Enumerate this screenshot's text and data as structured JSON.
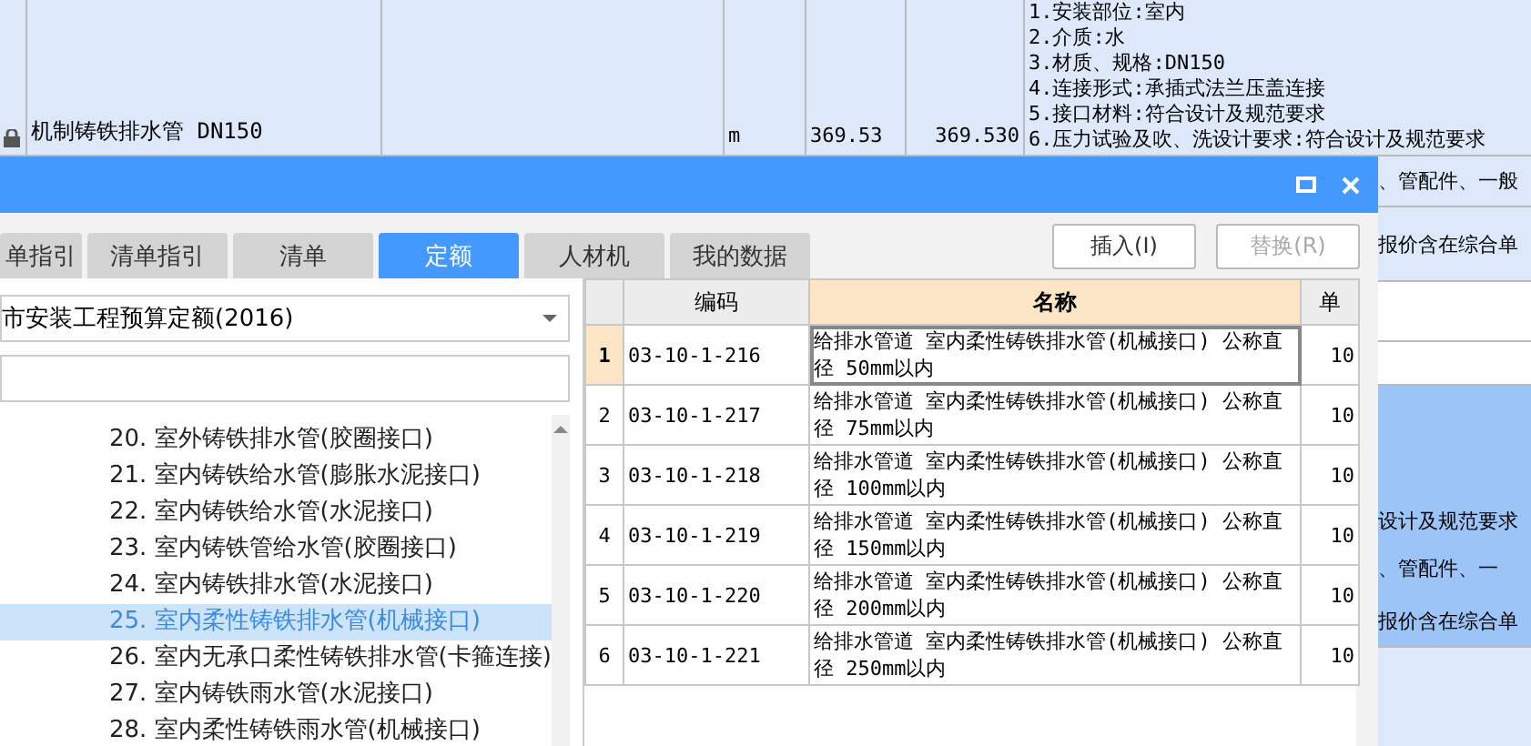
{
  "sheet": {
    "row": {
      "locked": true,
      "name": "机制铸铁排水管 DN150",
      "unit": "m",
      "quantity": "369.53",
      "amount": "369.530",
      "features": [
        "1.安装部位:室内",
        "2.介质:水",
        "3.材质、规格:DN150",
        "4.连接形式:承插式法兰压盖连接",
        "5.接口材料:符合设计及规范要求",
        "6.压力试验及吹、洗设计要求:符合设计及规范要求"
      ]
    },
    "side_rows": [
      {
        "text": "、管配件、一般",
        "selected": false
      },
      {
        "text": "报价含在综合单",
        "selected": false
      },
      {
        "text": "设计及规范要求",
        "selected": true
      },
      {
        "text": "、管配件、一",
        "selected": true
      },
      {
        "text": "报价含在综合单",
        "selected": true
      }
    ]
  },
  "dialog": {
    "tabs": [
      {
        "label": "单指引",
        "selected": false
      },
      {
        "label": "清单指引",
        "selected": false
      },
      {
        "label": "清单",
        "selected": false
      },
      {
        "label": "定额",
        "selected": true
      },
      {
        "label": "人材机",
        "selected": false
      },
      {
        "label": "我的数据",
        "selected": false
      }
    ],
    "buttons": [
      {
        "label": "插入(I)",
        "disabled": false
      },
      {
        "label": "替换(R)",
        "disabled": true
      }
    ],
    "library": "市安装工程预算定额(2016)",
    "tree": [
      {
        "label": "20. 室外铸铁排水管(胶圈接口)",
        "selected": false
      },
      {
        "label": "21. 室内铸铁给水管(膨胀水泥接口)",
        "selected": false
      },
      {
        "label": "22. 室内铸铁给水管(水泥接口)",
        "selected": false
      },
      {
        "label": "23. 室内铸铁管给水管(胶圈接口)",
        "selected": false
      },
      {
        "label": "24. 室内铸铁排水管(水泥接口)",
        "selected": false
      },
      {
        "label": "25. 室内柔性铸铁排水管(机械接口)",
        "selected": true
      },
      {
        "label": "26. 室内无承口柔性铸铁排水管(卡箍连接)",
        "selected": false
      },
      {
        "label": "27. 室内铸铁雨水管(水泥接口)",
        "selected": false
      },
      {
        "label": "28. 室内柔性铸铁雨水管(机械接口)",
        "selected": false
      }
    ],
    "table": {
      "columns": [
        "编码",
        "名称",
        "单"
      ],
      "rows": [
        {
          "index": "1",
          "code": "03-10-1-216",
          "name": "给排水管道 室内柔性铸铁排水管(机械接口) 公称直径 50mm以内",
          "unit": "10",
          "selected": true
        },
        {
          "index": "2",
          "code": "03-10-1-217",
          "name": "给排水管道 室内柔性铸铁排水管(机械接口) 公称直径 75mm以内",
          "unit": "10",
          "selected": false
        },
        {
          "index": "3",
          "code": "03-10-1-218",
          "name": "给排水管道 室内柔性铸铁排水管(机械接口) 公称直径 100mm以内",
          "unit": "10",
          "selected": false
        },
        {
          "index": "4",
          "code": "03-10-1-219",
          "name": "给排水管道 室内柔性铸铁排水管(机械接口) 公称直径 150mm以内",
          "unit": "10",
          "selected": false
        },
        {
          "index": "5",
          "code": "03-10-1-220",
          "name": "给排水管道 室内柔性铸铁排水管(机械接口) 公称直径 200mm以内",
          "unit": "10",
          "selected": false
        },
        {
          "index": "6",
          "code": "03-10-1-221",
          "name": "给排水管道 室内柔性铸铁排水管(机械接口) 公称直径 250mm以内",
          "unit": "10",
          "selected": false
        }
      ]
    }
  }
}
